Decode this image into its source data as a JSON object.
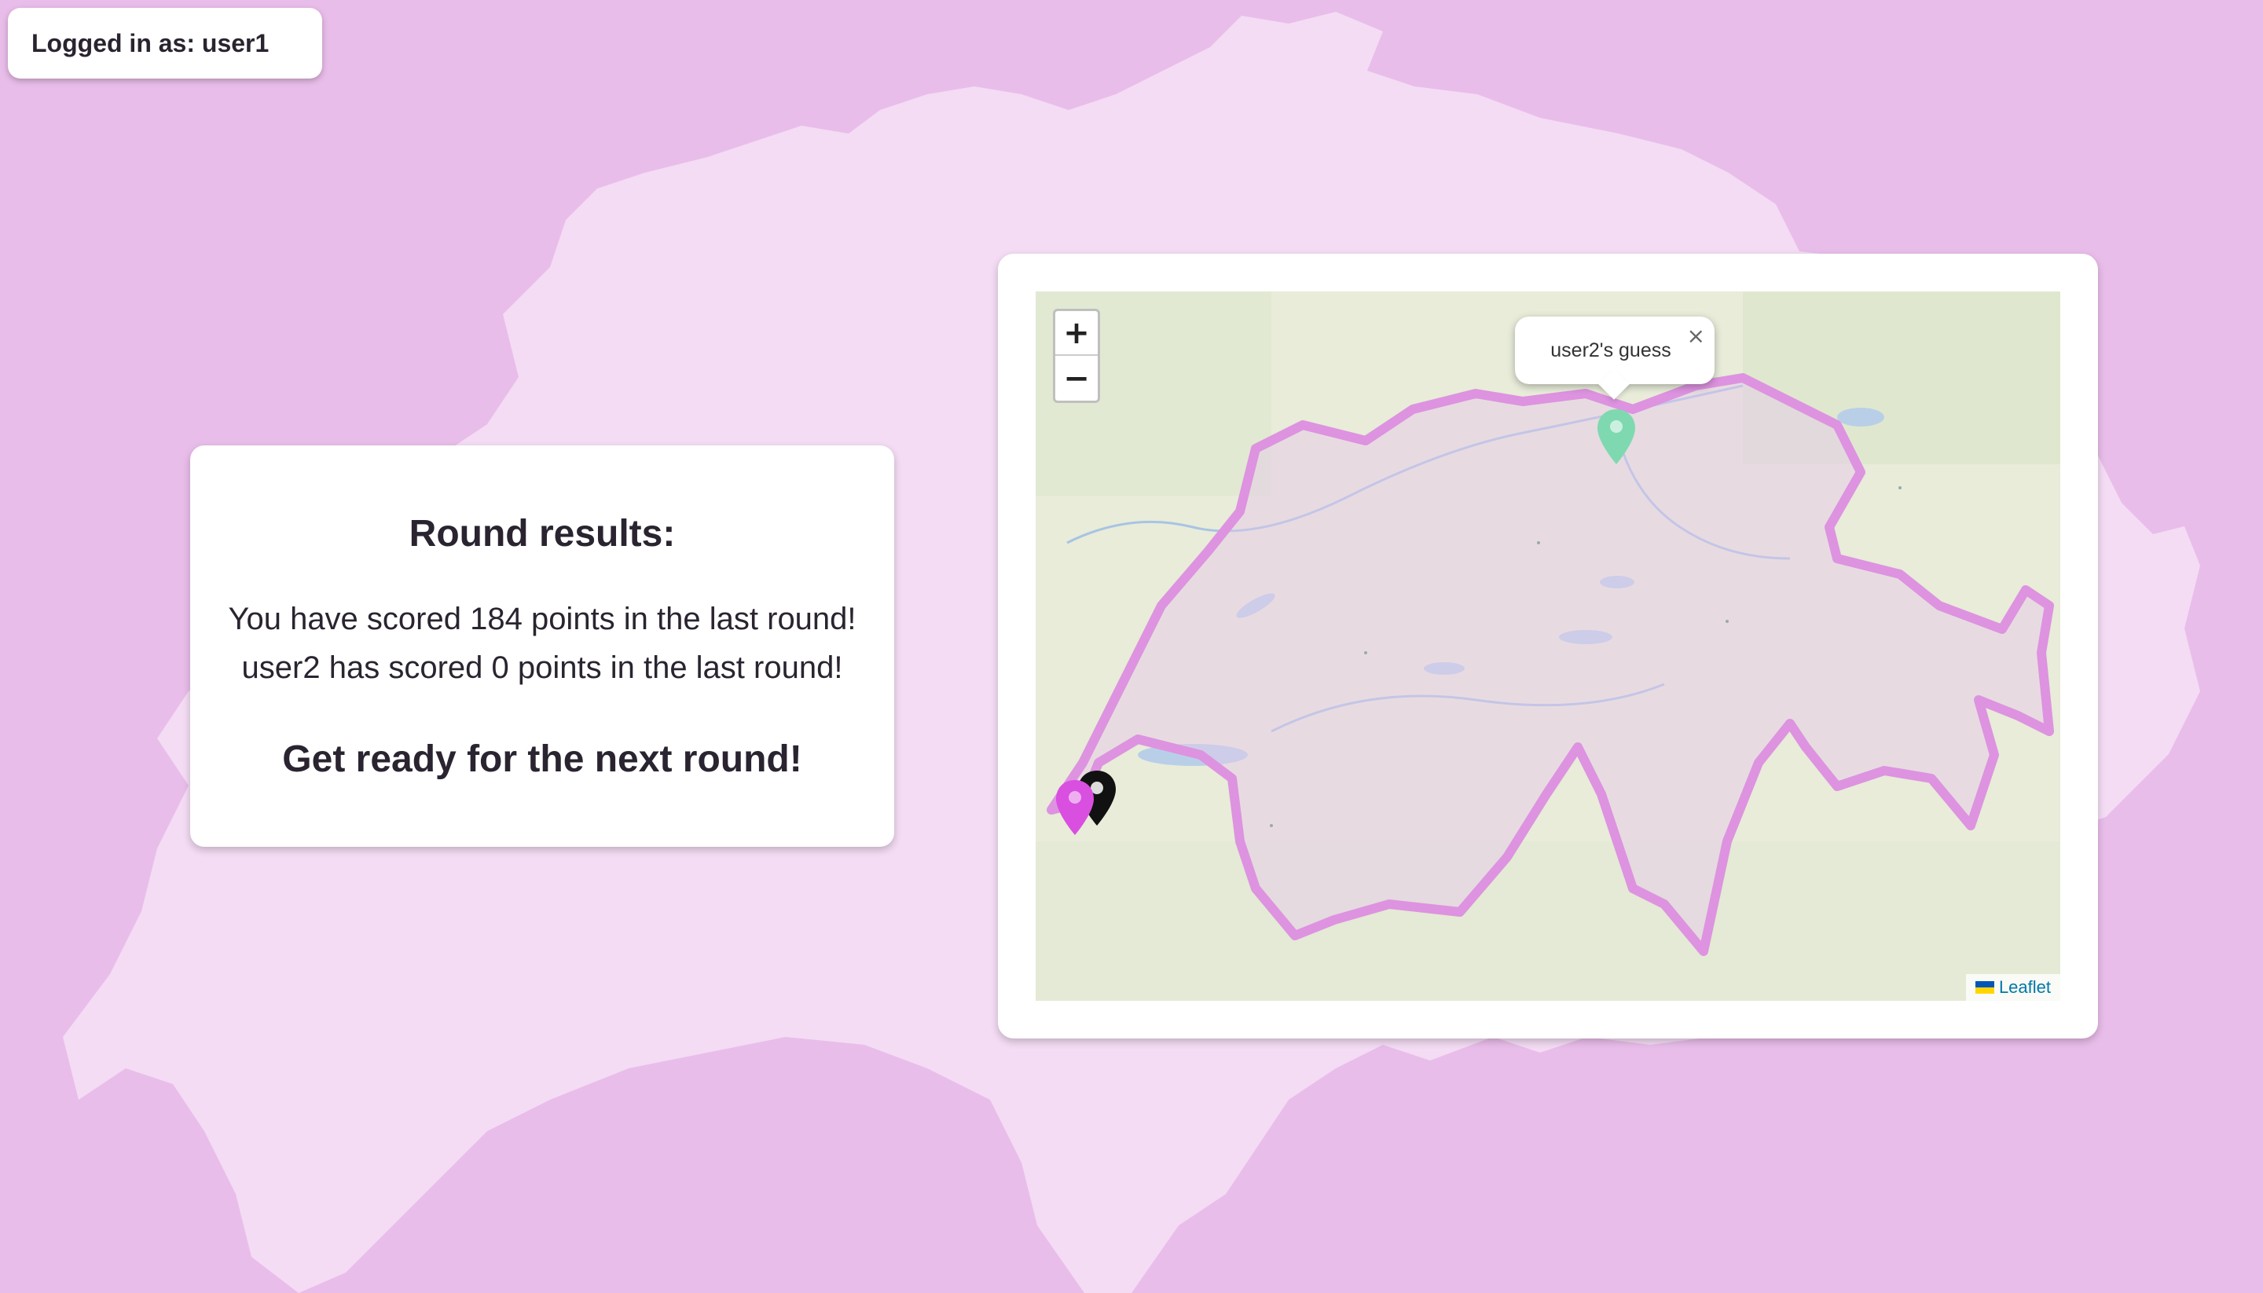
{
  "login": {
    "text": "Logged in as: user1"
  },
  "results": {
    "title": "Round results:",
    "lines": [
      "You have scored 184 points in the last round!",
      "user2 has scored 0 points in the last round!"
    ],
    "next": "Get ready for the next round!"
  },
  "map": {
    "zoom_in_label": "+",
    "zoom_out_label": "−",
    "popup_text": "user2's guess",
    "popup_close": "×",
    "attribution": "Leaflet",
    "markers": [
      {
        "name": "user2-guess-marker",
        "color": "#7fd9b0",
        "icon": "map-pin-icon"
      },
      {
        "name": "user1-guess-marker",
        "color": "#d94fe0",
        "icon": "map-pin-icon"
      },
      {
        "name": "actual-location-marker",
        "color": "#111111",
        "icon": "map-pin-icon"
      }
    ]
  },
  "colors": {
    "background": "#e9bdea",
    "silhouette": "#f4dcf4",
    "border": "#d98fdc"
  }
}
